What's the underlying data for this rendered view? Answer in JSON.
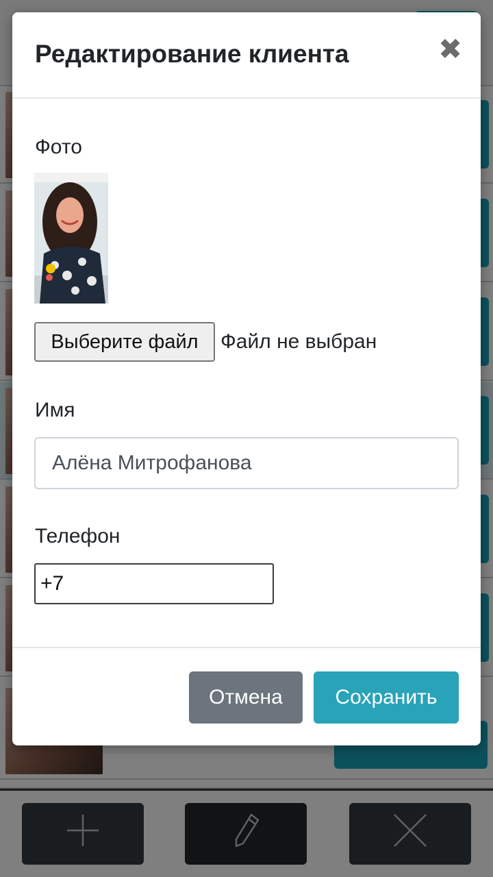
{
  "modal": {
    "title": "Редактирование клиента",
    "close_symbol": "✖"
  },
  "form": {
    "photo_label": "Фото",
    "file_button_label": "Выберите файл",
    "file_status": "Файл не выбран",
    "name_label": "Имя",
    "name_value": "Алёна Митрофанова",
    "phone_label": "Телефон",
    "phone_value": "+7"
  },
  "footer": {
    "cancel_label": "Отмена",
    "save_label": "Сохранить"
  },
  "toolbar": {
    "add_icon": "plus-icon",
    "edit_icon": "pencil-icon",
    "delete_icon": "close-icon"
  },
  "colors": {
    "primary": "#29a3b8",
    "secondary": "#6c757d",
    "toolbar_button": "#343a40"
  }
}
